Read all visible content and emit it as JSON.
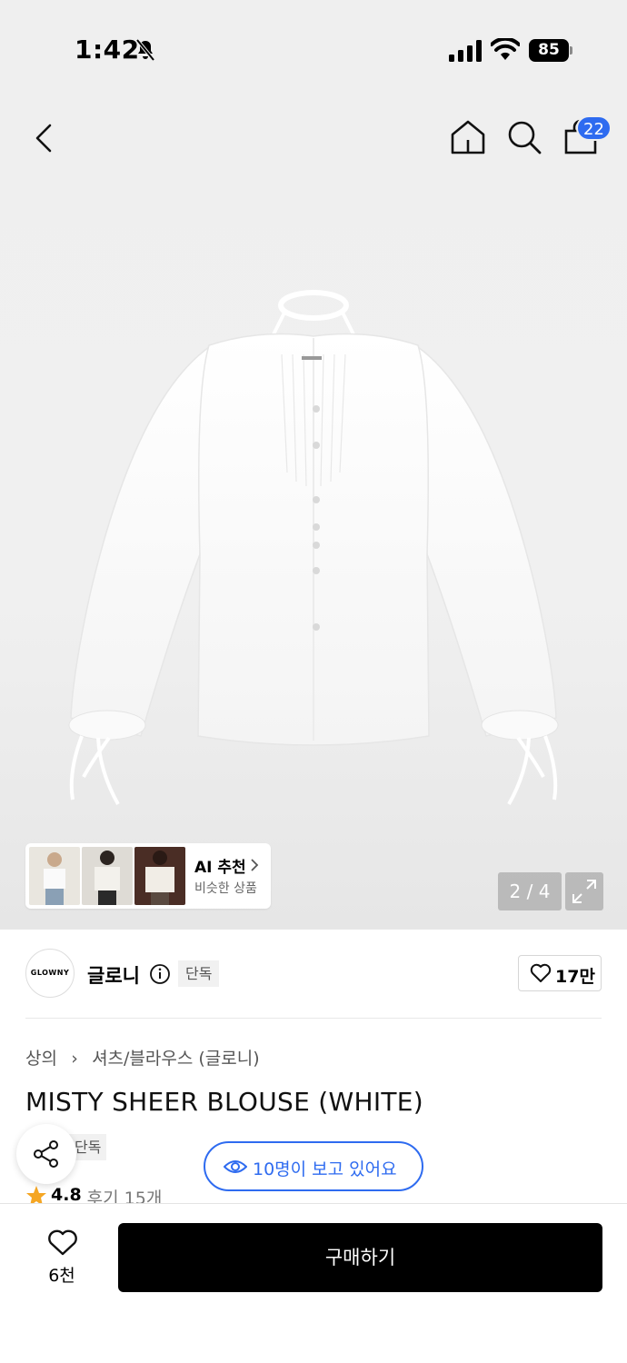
{
  "status": {
    "time": "1:42",
    "battery": "85"
  },
  "header": {
    "cart_count": "22"
  },
  "gallery": {
    "page_counter": "2 / 4"
  },
  "recommend": {
    "title": "AI 추천",
    "subtitle": "비슷한 상품"
  },
  "brand": {
    "logo_text": "GLOWNY",
    "name": "글로니",
    "tag": "단독",
    "like_count": "17만"
  },
  "product": {
    "breadcrumb": [
      "상의",
      "셔츠/블라우스 (글로니)"
    ],
    "title": "MISTY SHEER BLOUSE (WHITE)",
    "tag": "단독",
    "viewers": "10명이 보고 있어요",
    "rating": "4.8",
    "review_label": "후기 15개"
  },
  "bottom": {
    "wish_count": "6천",
    "buy_label": "구매하기"
  },
  "colors": {
    "accent_blue": "#2e6bf0",
    "star": "#f5a623",
    "buy": "#000000"
  }
}
